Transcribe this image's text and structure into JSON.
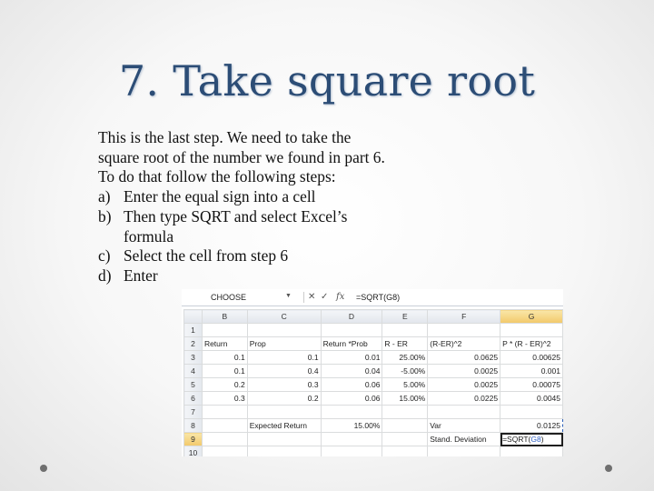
{
  "slide": {
    "title": "7. Take square root",
    "intro": "This is the last step. We need to take the square root of the number we found in part 6. To do that follow the following steps:",
    "steps": [
      {
        "marker": "a)",
        "text": "Enter the equal sign into a cell"
      },
      {
        "marker": "b)",
        "text": "Then type SQRT and select Excel’s formula"
      },
      {
        "marker": "c)",
        "text": "Select the cell from step 6"
      },
      {
        "marker": "d)",
        "text": "Enter"
      }
    ]
  },
  "spreadsheet": {
    "name_box": "CHOOSE",
    "cancel_icon": "close-icon",
    "enter_icon": "check-icon",
    "fx_label": "fx",
    "formula": "=SQRT(G8)",
    "columns": [
      "B",
      "C",
      "D",
      "E",
      "F",
      "G"
    ],
    "row_numbers": [
      "1",
      "2",
      "3",
      "4",
      "5",
      "6",
      "7",
      "8",
      "9",
      "10"
    ],
    "headers": [
      "Return",
      "Prop",
      "Return *Prob",
      "R - ER",
      "(R-ER)^2",
      "P * (R - ER)^2"
    ],
    "rows": [
      [
        "0.1",
        "0.1",
        "0.01",
        "25.00%",
        "0.0625",
        "0.00625"
      ],
      [
        "0.1",
        "0.4",
        "0.04",
        "-5.00%",
        "0.0025",
        "0.001"
      ],
      [
        "0.2",
        "0.3",
        "0.06",
        "5.00%",
        "0.0025",
        "0.00075"
      ],
      [
        "0.3",
        "0.2",
        "0.06",
        "15.00%",
        "0.0225",
        "0.0045"
      ]
    ],
    "expected_return_label": "Expected Return",
    "expected_return_value": "15.00%",
    "var_label": "Var",
    "var_value": "0.0125",
    "stdev_label": "Stand. Deviation",
    "stdev_formula_prefix": "=SQRT(",
    "stdev_formula_ref": "G8",
    "stdev_formula_suffix": ")"
  }
}
